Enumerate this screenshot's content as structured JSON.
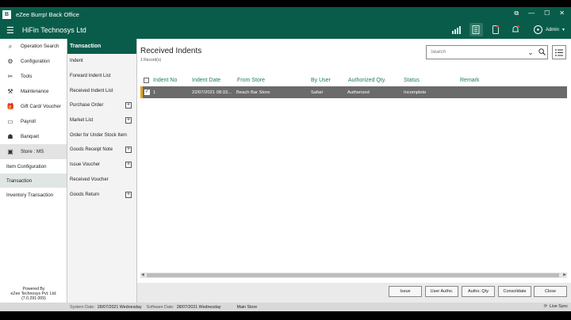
{
  "window": {
    "logo_text": "B",
    "title": "eZee Burrp! Back Office",
    "controls": [
      "⧉",
      "—",
      "☐",
      "✕"
    ]
  },
  "header": {
    "company": "HiFin Technosys Ltd",
    "user": "Admin",
    "icons": [
      "chart-icon",
      "document-icon",
      "mobile-icon",
      "bell-icon"
    ]
  },
  "sidebar": {
    "items": [
      {
        "label": "Operation Search",
        "icon": "⌕"
      },
      {
        "label": "Configuration",
        "icon": "⚙"
      },
      {
        "label": "Tools",
        "icon": "✂"
      },
      {
        "label": "Maintenance",
        "icon": "⚒"
      },
      {
        "label": "Gift Card/ Voucher",
        "icon": "🎁"
      },
      {
        "label": "Payroll",
        "icon": "▭"
      },
      {
        "label": "Banquet",
        "icon": "☗"
      }
    ],
    "store": {
      "label": "Store : MS",
      "icon": "▣"
    },
    "sub_items": [
      "Item Configuration",
      "Transaction",
      "Inventory Transaction"
    ],
    "powered": [
      "Powered By",
      "eZee Technosys Pvt. Ltd.",
      "(7.0.291.009)"
    ]
  },
  "submenu": {
    "title": "Transaction",
    "items": [
      {
        "label": "Indent",
        "plus": false
      },
      {
        "label": "Forward Indent List",
        "plus": false
      },
      {
        "label": "Received Indent List",
        "plus": false
      },
      {
        "label": "Purchase Order",
        "plus": true
      },
      {
        "label": " Market List",
        "plus": true
      },
      {
        "label": "Order for Under Stock Item",
        "plus": false
      },
      {
        "label": "Goods Receipt Note",
        "plus": true
      },
      {
        "label": "Issue Voucher",
        "plus": true
      },
      {
        "label": "Received Voucher",
        "plus": false
      },
      {
        "label": "Goods Return",
        "plus": true
      }
    ]
  },
  "main": {
    "title": "Received Indents",
    "record_count": "1 Record(s)",
    "search_placeholder": "Search",
    "columns": [
      "Indent No",
      "Indent Date",
      "From Store",
      "By User",
      "Authorized Qty.",
      "Status",
      "Remark"
    ],
    "rows": [
      {
        "indent_no": "1",
        "date": "22/07/2021 08:33...",
        "from_store": "Beach Bar Store",
        "by_user": "Safari",
        "authorized": "Authorized",
        "status": "Incomplete",
        "remark": ""
      }
    ],
    "buttons": [
      "Issue",
      "User Autho.",
      "Autho. Qty",
      "Consolidate",
      "Close"
    ]
  },
  "status_bar": {
    "system_date_label": "System Date:",
    "system_date": "28/07/2021 Wednesday",
    "software_date_label": "Software Date:",
    "software_date": "28/07/2021 Wednesday",
    "store": "Main Store",
    "live_sync": "Live Sync"
  }
}
